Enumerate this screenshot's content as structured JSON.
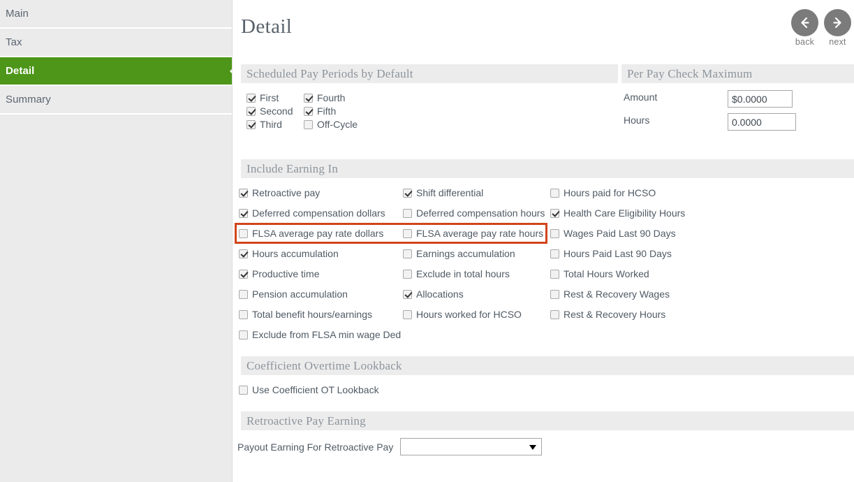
{
  "sidebar": {
    "items": [
      {
        "label": "Main",
        "selected": false
      },
      {
        "label": "Tax",
        "selected": false
      },
      {
        "label": "Detail",
        "selected": true
      },
      {
        "label": "Summary",
        "selected": false
      }
    ]
  },
  "header": {
    "title": "Detail",
    "back_label": "back",
    "next_label": "next",
    "back_icon": "arrow-left-icon",
    "next_icon": "arrow-right-icon"
  },
  "sections": {
    "scheduled_pay_periods": {
      "title": "Scheduled Pay Periods by Default",
      "col1": [
        {
          "label": "First",
          "checked": true
        },
        {
          "label": "Second",
          "checked": true
        },
        {
          "label": "Third",
          "checked": true
        }
      ],
      "col2": [
        {
          "label": "Fourth",
          "checked": true
        },
        {
          "label": "Fifth",
          "checked": true
        },
        {
          "label": "Off-Cycle",
          "checked": false
        }
      ]
    },
    "per_pay_check_maximum": {
      "title": "Per Pay Check Maximum",
      "amount_label": "Amount",
      "amount_value": "$0.0000",
      "hours_label": "Hours",
      "hours_value": "0.0000"
    },
    "include_earning_in": {
      "title": "Include Earning In",
      "col1": [
        {
          "label": "Retroactive pay",
          "checked": true
        },
        {
          "label": "Deferred compensation dollars",
          "checked": true
        },
        {
          "label": "FLSA average pay rate dollars",
          "checked": false
        },
        {
          "label": "Hours accumulation",
          "checked": true
        },
        {
          "label": "Productive time",
          "checked": true
        },
        {
          "label": "Pension accumulation",
          "checked": false
        },
        {
          "label": "Total benefit hours/earnings",
          "checked": false
        },
        {
          "label": "Exclude from FLSA min wage Ded",
          "checked": false
        }
      ],
      "col2": [
        {
          "label": "Shift differential",
          "checked": true
        },
        {
          "label": "Deferred compensation hours",
          "checked": false
        },
        {
          "label": "FLSA average pay rate hours",
          "checked": false
        },
        {
          "label": "Earnings accumulation",
          "checked": false
        },
        {
          "label": "Exclude in total hours",
          "checked": false
        },
        {
          "label": "Allocations",
          "checked": true
        },
        {
          "label": "Hours worked for HCSO",
          "checked": false
        }
      ],
      "col3": [
        {
          "label": "Hours paid for HCSO",
          "checked": false
        },
        {
          "label": "Health Care Eligibility Hours",
          "checked": true
        },
        {
          "label": "Wages Paid Last 90 Days",
          "checked": false
        },
        {
          "label": "Hours Paid Last 90 Days",
          "checked": false
        },
        {
          "label": "Total Hours Worked",
          "checked": false
        },
        {
          "label": "Rest & Recovery Wages",
          "checked": false
        },
        {
          "label": "Rest & Recovery Hours",
          "checked": false
        }
      ]
    },
    "coefficient_overtime_lookback": {
      "title": "Coefficient Overtime Lookback",
      "use_lookback": {
        "label": "Use Coefficient OT Lookback",
        "checked": false
      }
    },
    "retroactive_pay_earning": {
      "title": "Retroactive Pay Earning",
      "payout_label": "Payout Earning For Retroactive Pay",
      "payout_value": ""
    }
  },
  "annotation": {
    "highlight_color": "#d1451c",
    "highlighted_rows": [
      "FLSA average pay rate dollars",
      "FLSA average pay rate hours"
    ]
  },
  "colors": {
    "accent_green": "#4d9619",
    "section_bar": "#ececec",
    "sidebar_bg": "#ebebeb",
    "label_text": "#4f5a64",
    "muted_text": "#8d949b"
  }
}
